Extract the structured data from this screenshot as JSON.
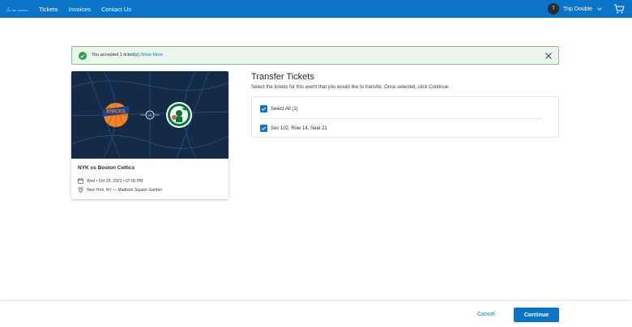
{
  "colors": {
    "brand": "#0c74c8",
    "success_bg": "#eaf6ec",
    "success_border": "#7cc88a",
    "success_icon": "#2ea043",
    "card_bg": "#152a47"
  },
  "header": {
    "nav": [
      {
        "label": "Tickets"
      },
      {
        "label": "Invoices"
      },
      {
        "label": "Contact Us"
      }
    ],
    "user": {
      "initial": "T",
      "name": "Trip Double"
    },
    "icons": {
      "logo": "brand-logo",
      "cart": "cart-icon",
      "dropdown": "chevron-down-icon"
    }
  },
  "alert": {
    "message": "You accepted 1 ticket(s).",
    "link": "Show More",
    "icons": {
      "status": "check-circle-icon",
      "close": "close-icon"
    }
  },
  "event": {
    "title": "NYK vs Boston Celtics",
    "date": "Wed • Oct 25, 2023 • 07:00 PM",
    "location": "New York, NY — Madison Square Garden",
    "image": {
      "home_logo": "KNICKS",
      "versus": "VS"
    },
    "icons": {
      "date": "calendar-icon",
      "location": "location-pin-icon"
    }
  },
  "transfer": {
    "title": "Transfer Tickets",
    "subtitle": "Select the tickets for this event that you would like to transfer. Once selected, click Continue.",
    "select_all": {
      "label": "Select All (1)",
      "checked": true
    },
    "tickets": [
      {
        "label": "Sec 102, Row 14, Seat 21",
        "checked": true
      }
    ]
  },
  "footer": {
    "cancel_label": "Cancel",
    "continue_label": "Continue"
  }
}
